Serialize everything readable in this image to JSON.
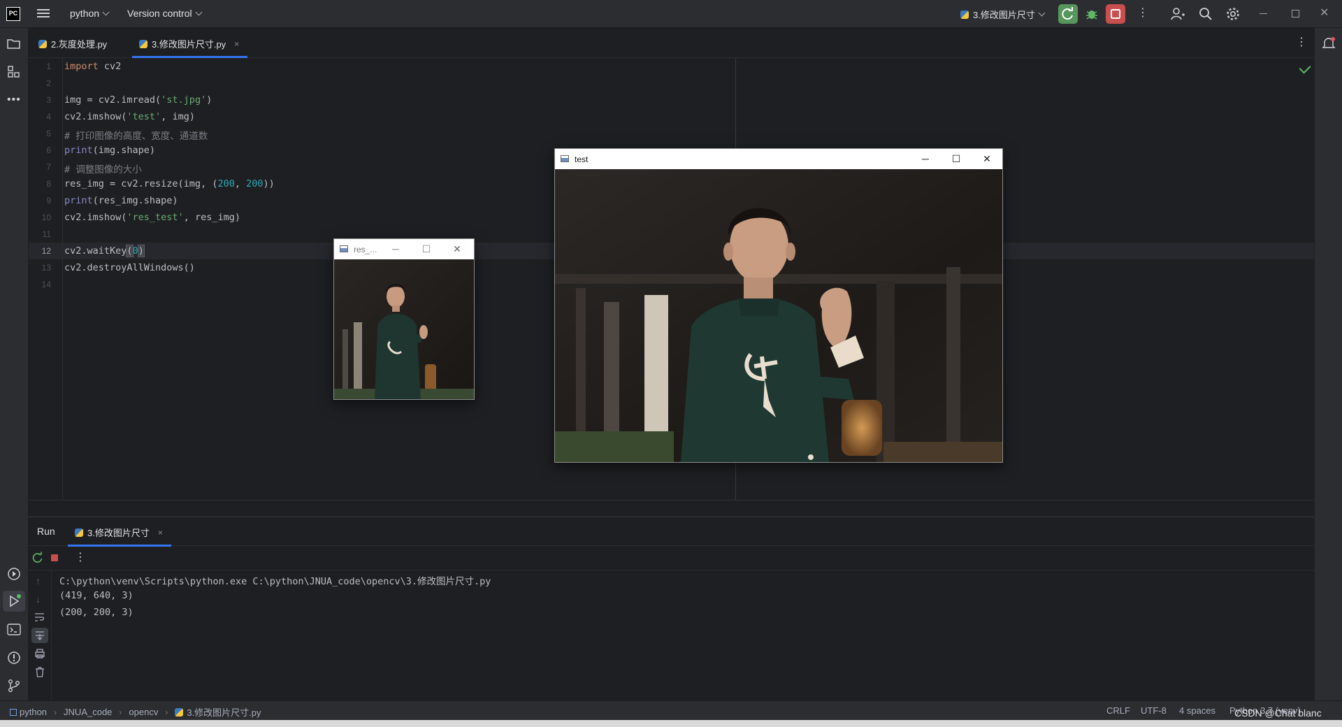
{
  "titlebar": {
    "project": "python",
    "vcs": "Version control",
    "run_config": "3.修改图片尺寸"
  },
  "editor_tabs": [
    {
      "label": "2.灰度处理.py"
    },
    {
      "label": "3.修改图片尺寸.py",
      "close": "×"
    }
  ],
  "editor": {
    "line_numbers": [
      "1",
      "2",
      "3",
      "4",
      "5",
      "6",
      "7",
      "8",
      "9",
      "10",
      "11",
      "12",
      "13",
      "14"
    ],
    "current_line": "12",
    "code": {
      "l1_kw": "import",
      "l1_rest": " cv2",
      "l3_a": "img = cv2.imread(",
      "l3_s": "'st.jpg'",
      "l3_b": ")",
      "l4_a": "cv2.imshow(",
      "l4_s": "'test'",
      "l4_b": ", img)",
      "l5": "# 打印图像的高度、宽度、通道数",
      "l6_f": "print",
      "l6_b": "(img.shape)",
      "l7": "# 调整图像的大小",
      "l8_a": "res_img = cv2.resize(img, (",
      "l8_n1": "200",
      "l8_c": ", ",
      "l8_n2": "200",
      "l8_b": "))",
      "l9_f": "print",
      "l9_b": "(res_img.shape)",
      "l10_a": "cv2.imshow(",
      "l10_s": "'res_test'",
      "l10_b": ", res_img)",
      "l12_a": "cv2.waitKey",
      "l12_p1": "(",
      "l12_n": "0",
      "l12_p2": ")",
      "l13": "cv2.destroyAllWindows()"
    }
  },
  "run_panel": {
    "label": "Run",
    "tab": "3.修改图片尺寸",
    "tab_close": "×",
    "output": [
      "C:\\python\\venv\\Scripts\\python.exe C:\\python\\JNUA_code\\opencv\\3.修改图片尺寸.py",
      "(419, 640, 3)",
      "(200, 200, 3)"
    ]
  },
  "statusbar": {
    "breadcrumb": [
      "python",
      "JNUA_code",
      "opencv",
      "3.修改图片尺寸.py"
    ],
    "line_sep": "CRLF",
    "encoding": "UTF-8",
    "indent": "4 spaces",
    "interpreter": "Python 3.7 (venv)"
  },
  "watermark": "CSDN @Chat blanc",
  "windows": {
    "small_title": "res_...",
    "large_title": "test"
  },
  "icons": {
    "run": "rerun-icon",
    "debug": "bug-icon",
    "stop": "stop-icon",
    "search": "search-icon",
    "settings": "gear-icon",
    "account": "account-icon"
  },
  "colors": {
    "accent": "#3574f0",
    "run_green": "#57965c",
    "stop_red": "#c94f4f"
  }
}
